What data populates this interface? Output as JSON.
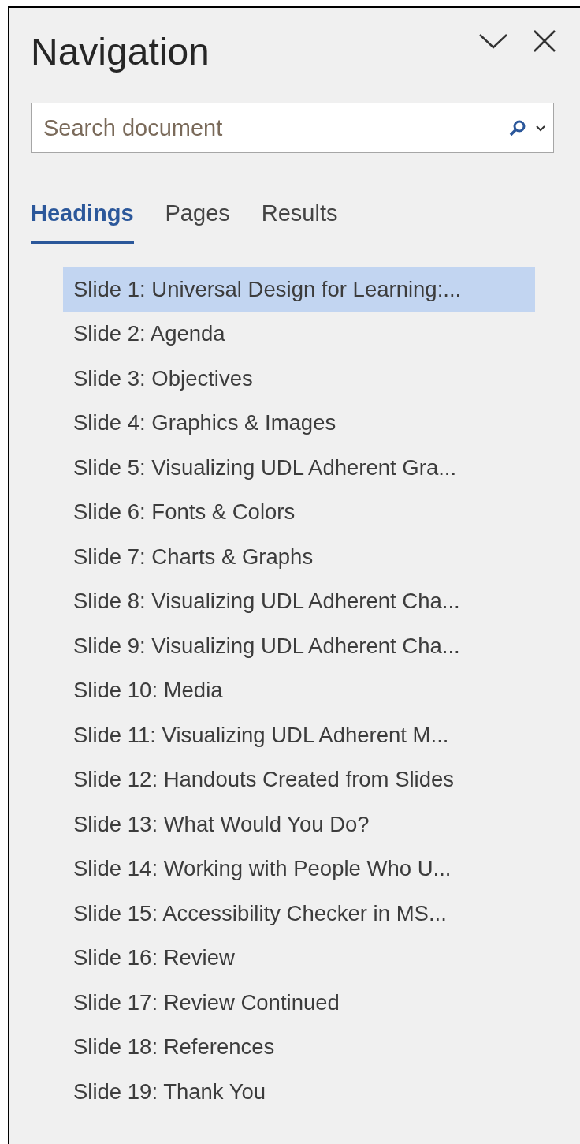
{
  "pane": {
    "title": "Navigation"
  },
  "search": {
    "placeholder": "Search document"
  },
  "tabs": [
    {
      "label": "Headings",
      "selected": true
    },
    {
      "label": "Pages",
      "selected": false
    },
    {
      "label": "Results",
      "selected": false
    }
  ],
  "headings": [
    {
      "text": "Slide 1: Universal Design for Learning:...",
      "selected": true
    },
    {
      "text": "Slide 2: Agenda",
      "selected": false
    },
    {
      "text": "Slide 3: Objectives",
      "selected": false
    },
    {
      "text": "Slide 4: Graphics & Images",
      "selected": false
    },
    {
      "text": "Slide 5: Visualizing UDL Adherent Gra...",
      "selected": false
    },
    {
      "text": "Slide 6: Fonts & Colors",
      "selected": false
    },
    {
      "text": "Slide 7: Charts & Graphs",
      "selected": false
    },
    {
      "text": "Slide 8: Visualizing UDL Adherent Cha...",
      "selected": false
    },
    {
      "text": "Slide 9: Visualizing UDL Adherent Cha...",
      "selected": false
    },
    {
      "text": "Slide 10: Media",
      "selected": false
    },
    {
      "text": "Slide 11: Visualizing UDL Adherent M...",
      "selected": false
    },
    {
      "text": "Slide 12: Handouts Created from Slides",
      "selected": false
    },
    {
      "text": "Slide 13: What Would You Do?",
      "selected": false
    },
    {
      "text": "Slide 14: Working with People Who U...",
      "selected": false
    },
    {
      "text": "Slide 15: Accessibility Checker in MS...",
      "selected": false
    },
    {
      "text": "Slide 16: Review",
      "selected": false
    },
    {
      "text": "Slide 17: Review Continued",
      "selected": false
    },
    {
      "text": "Slide 18: References",
      "selected": false
    },
    {
      "text": "Slide 19: Thank You",
      "selected": false
    }
  ]
}
